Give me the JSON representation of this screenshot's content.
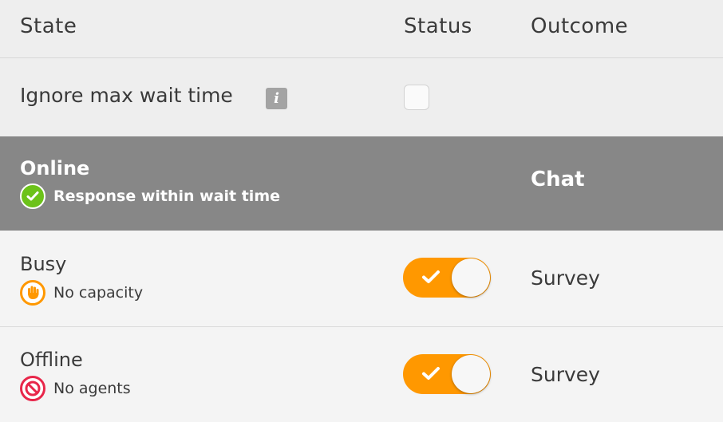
{
  "header": {
    "state": "State",
    "status": "Status",
    "outcome": "Outcome"
  },
  "ignore_row": {
    "label": "Ignore max wait time",
    "info_icon": "i",
    "checked": false
  },
  "rows": [
    {
      "state": "Online",
      "detail": "Response within wait time",
      "icon": "check-circle-icon",
      "outcome": "Chat",
      "status": null
    },
    {
      "state": "Busy",
      "detail": "No capacity",
      "icon": "hand-icon",
      "toggle_on": true,
      "outcome": "Survey"
    },
    {
      "state": "Offline",
      "detail": "No agents",
      "icon": "no-entry-icon",
      "toggle_on": true,
      "outcome": "Survey"
    }
  ],
  "colors": {
    "toggle_on": "#ff9800",
    "online_row": "#878787",
    "green": "#6cc21a",
    "red": "#e8264a"
  }
}
